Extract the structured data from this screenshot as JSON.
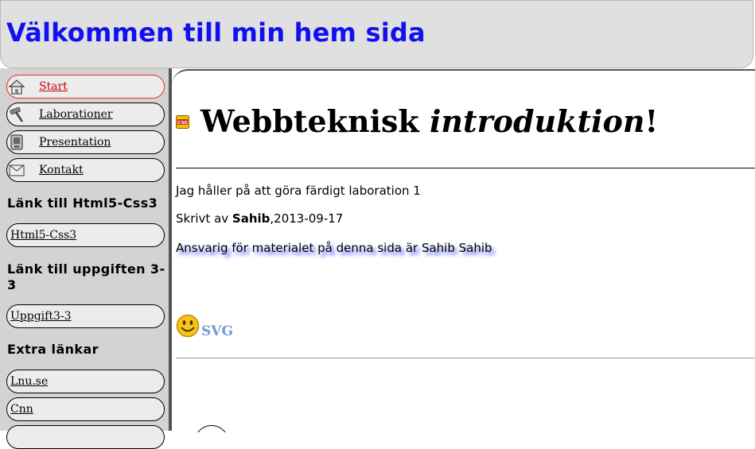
{
  "header": {
    "title": "Välkommen till min hem sida"
  },
  "nav": {
    "items": [
      {
        "label": "Start",
        "icon": "home-icon",
        "active": true
      },
      {
        "label": "Laborationer",
        "icon": "hammer-icon",
        "active": false
      },
      {
        "label": "Presentation",
        "icon": "phone-icon",
        "active": false
      },
      {
        "label": "Kontakt",
        "icon": "envelope-icon",
        "active": false
      }
    ]
  },
  "sidebar": {
    "sections": [
      {
        "heading": "Länk till Html5-Css3",
        "links": [
          "Html5-Css3"
        ]
      },
      {
        "heading": "Länk till uppgiften 3-3",
        "links": [
          "Uppgift3-3"
        ]
      },
      {
        "heading": "Extra länkar",
        "links": [
          "Lnu.se",
          "Cnn"
        ]
      }
    ]
  },
  "main": {
    "heading_part1": "Webbteknisk ",
    "heading_italic": "introduktion",
    "heading_part3": "!",
    "paragraph1": "Jag håller på att göra färdigt laboration 1",
    "author_prefix": "Skrivt av ",
    "author_name": "Sahib",
    "author_date": ",2013-09-17",
    "responsible": "Ansvarig för materialet på denna sida är Sahib Sahib",
    "svg_link": "SVG"
  },
  "colors": {
    "title_blue": "#1010f0",
    "active_nav_border": "#e23030",
    "active_nav_text": "#cc0000",
    "svg_link": "#6f9ad8",
    "text_shadow": "#4d4dff",
    "sidebar_bg": "#d3d3d3",
    "header_bg": "#e0e0e0"
  }
}
